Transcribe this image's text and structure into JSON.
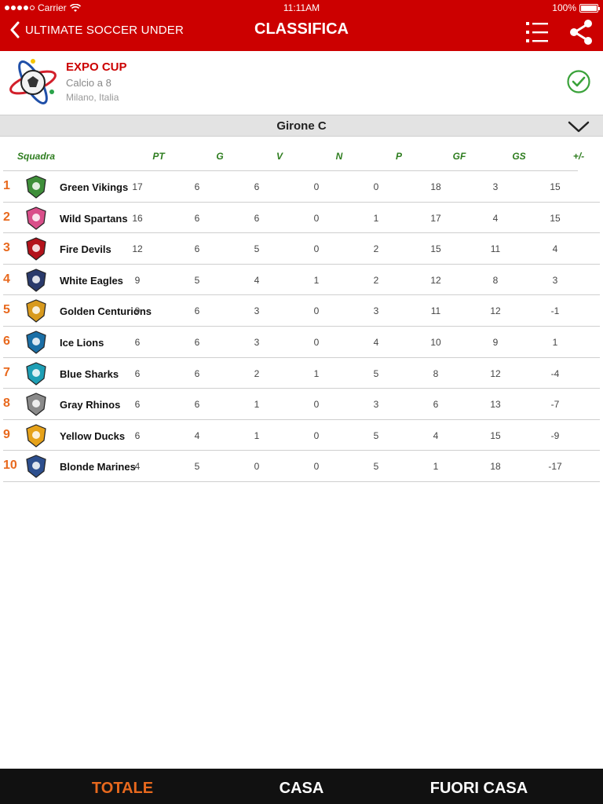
{
  "status_bar": {
    "carrier": "Carrier",
    "time": "11:11AM",
    "battery": "100%"
  },
  "header": {
    "back_label": "ULTIMATE SOCCER UNDER",
    "title": "CLASSIFICA",
    "list_icon": "list-icon",
    "share_icon": "share-icon",
    "bg_color": "#cc0000"
  },
  "tournament": {
    "name": "EXPO CUP",
    "type": "Calcio a 8",
    "place": "Milano, Italia",
    "check_icon": "check-circle-icon"
  },
  "group": {
    "label": "Girone C",
    "chevron_icon": "chevron-down-icon"
  },
  "table": {
    "headers": {
      "team": "Squadra",
      "pt": "PT",
      "g": "G",
      "v": "V",
      "n": "N",
      "p": "P",
      "gf": "GF",
      "gs": "GS",
      "diff": "+/-"
    },
    "rows": [
      {
        "rank": "1",
        "team": "Green Vikings",
        "pt": "17",
        "g": "6",
        "v": "6",
        "n": "0",
        "p": "0",
        "gf": "18",
        "gs": "3",
        "diff": "15",
        "color": "#3f8f3a"
      },
      {
        "rank": "2",
        "team": "Wild Spartans",
        "pt": "16",
        "g": "6",
        "v": "6",
        "n": "0",
        "p": "1",
        "gf": "17",
        "gs": "4",
        "diff": "15",
        "color": "#d94f8a"
      },
      {
        "rank": "3",
        "team": "Fire Devils",
        "pt": "12",
        "g": "6",
        "v": "5",
        "n": "0",
        "p": "2",
        "gf": "15",
        "gs": "11",
        "diff": "4",
        "color": "#b3121b"
      },
      {
        "rank": "4",
        "team": "White Eagles",
        "pt": "9",
        "g": "5",
        "v": "4",
        "n": "1",
        "p": "2",
        "gf": "12",
        "gs": "8",
        "diff": "3",
        "color": "#2a3a6b"
      },
      {
        "rank": "5",
        "team": "Golden Centurions",
        "pt": "9",
        "g": "6",
        "v": "3",
        "n": "0",
        "p": "3",
        "gf": "11",
        "gs": "12",
        "diff": "-1",
        "color": "#d89a1e"
      },
      {
        "rank": "6",
        "team": "Ice Lions",
        "pt": "6",
        "g": "6",
        "v": "3",
        "n": "0",
        "p": "4",
        "gf": "10",
        "gs": "9",
        "diff": "1",
        "color": "#1b6fa6"
      },
      {
        "rank": "7",
        "team": "Blue Sharks",
        "pt": "6",
        "g": "6",
        "v": "2",
        "n": "1",
        "p": "5",
        "gf": "8",
        "gs": "12",
        "diff": "-4",
        "color": "#1e9fb5"
      },
      {
        "rank": "8",
        "team": "Gray Rhinos",
        "pt": "6",
        "g": "6",
        "v": "1",
        "n": "0",
        "p": "3",
        "gf": "6",
        "gs": "13",
        "diff": "-7",
        "color": "#8a8a8a"
      },
      {
        "rank": "9",
        "team": "Yellow Ducks",
        "pt": "6",
        "g": "4",
        "v": "1",
        "n": "0",
        "p": "5",
        "gf": "4",
        "gs": "15",
        "diff": "-9",
        "color": "#e6a21a"
      },
      {
        "rank": "10",
        "team": "Blonde Marines",
        "pt": "4",
        "g": "5",
        "v": "0",
        "n": "0",
        "p": "5",
        "gf": "1",
        "gs": "18",
        "diff": "-17",
        "color": "#2d4f8e"
      }
    ]
  },
  "bottom_tabs": [
    {
      "label": "TOTALE",
      "active": true
    },
    {
      "label": "CASA",
      "active": false
    },
    {
      "label": "FUORI CASA",
      "active": false
    }
  ],
  "colors": {
    "accent": "#e8691e",
    "header_green": "#2e7d1f",
    "check_green": "#3aa23a"
  }
}
